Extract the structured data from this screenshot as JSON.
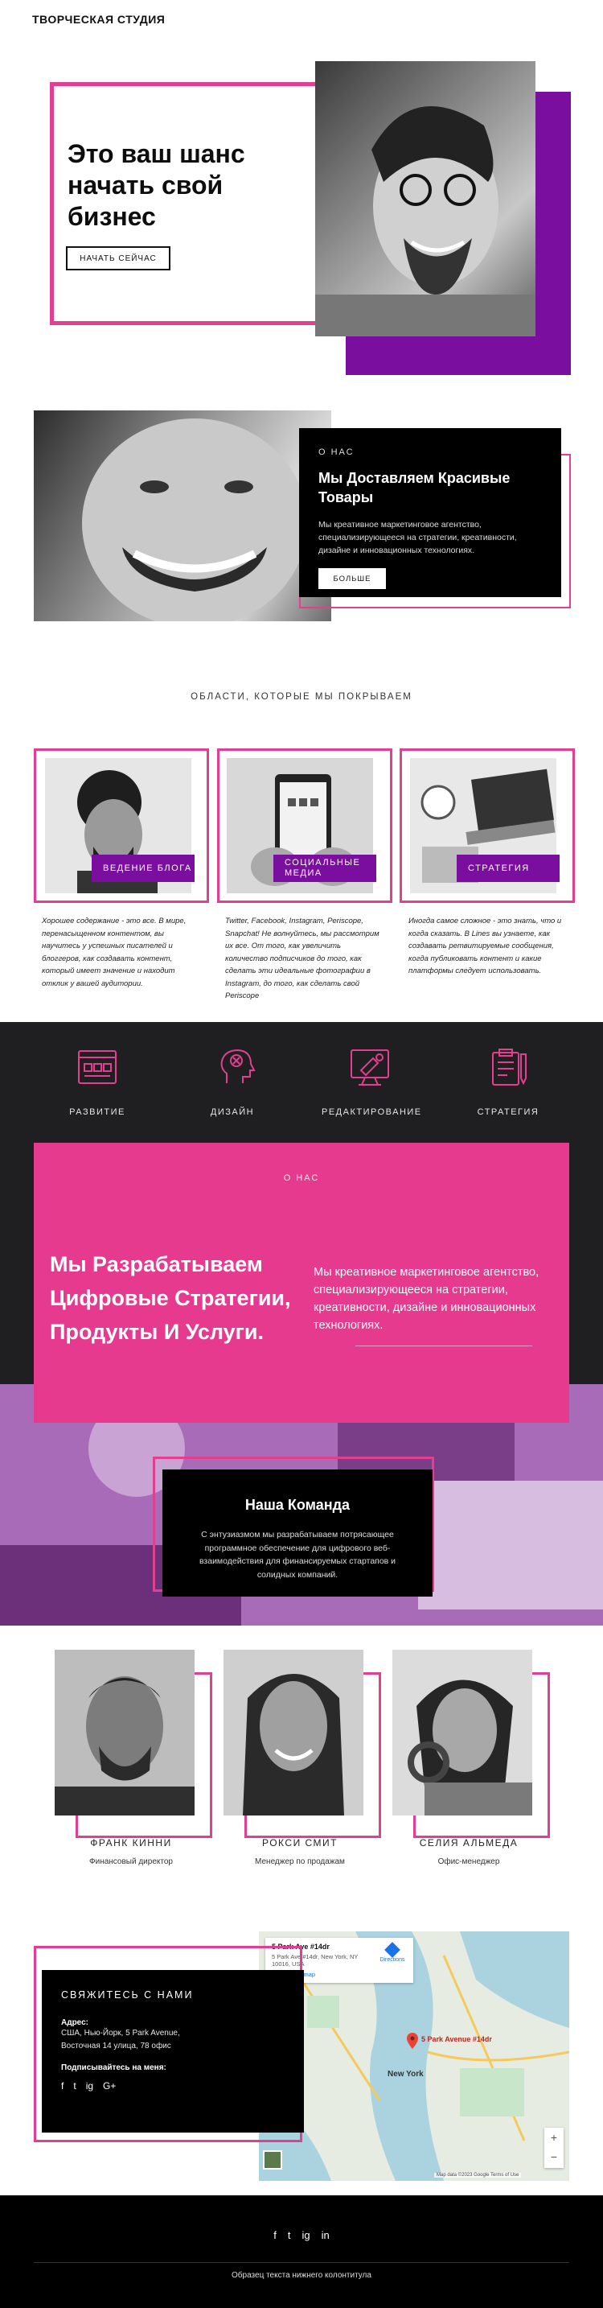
{
  "header": {
    "title": "ТВОРЧЕСКАЯ СТУДИЯ"
  },
  "hero": {
    "headline": "Это ваш шанс начать свой бизнес",
    "button": "НАЧАТЬ СЕЙЧАС"
  },
  "about": {
    "eyebrow": "О НАС",
    "title": "Мы Доставляем Красивые Товары",
    "text": "Мы креативное маркетинговое агентство, специализирующееся на стратегии, креативности, дизайне и инновационных технологиях.",
    "button": "БОЛЬШЕ"
  },
  "areas": {
    "caption": "ОБЛАСТИ, КОТОРЫЕ МЫ ПОКРЫВАЕМ",
    "cards": [
      {
        "tag": "ВЕДЕНИЕ БЛОГА",
        "text": "Хорошее содержание - это все. В мире, перенасыщенном контентом, вы научитесь у успешных писателей и блоггеров, как создавать контент, который имеет значение и находит отклик у вашей аудитории."
      },
      {
        "tag": "СОЦИАЛЬНЫЕ МЕДИА",
        "text": "Twitter, Facebook, Instagram, Periscope, Snapchat! Не волнуйтесь, мы рассмотрим их все. От того, как увеличить количество подписчиков до того, как сделать эти идеальные фотографии в Instagram, до того, как сделать свой Periscope"
      },
      {
        "tag": "СТРАТЕГИЯ",
        "text": "Иногда самое сложное - это знать, что и когда сказать. В Lines вы узнаете, как создавать ретвитируемые сообщения, когда публиковать контент и какие платформы следует использовать."
      }
    ]
  },
  "services": [
    {
      "label": "РАЗВИТИЕ",
      "icon": "browser-grid-icon"
    },
    {
      "label": "ДИЗАЙН",
      "icon": "head-idea-icon"
    },
    {
      "label": "РЕДАКТИРОВАНИЕ",
      "icon": "monitor-edit-icon"
    },
    {
      "label": "СТРАТЕГИЯ",
      "icon": "clipboard-strategy-icon"
    }
  ],
  "pink_about": {
    "eyebrow": "О НАС",
    "title": "Мы Разрабатываем Цифровые Стратегии, Продукты И Услуги.",
    "text": "Мы креативное маркетинговое агентство, специализирующееся на стратегии, креативности, дизайне и инновационных технологиях."
  },
  "team": {
    "title": "Наша Команда",
    "text": "С энтузиазмом мы разрабатываем потрясающее программное обеспечение для цифрового веб-взаимодействия для финансируемых стартапов и солидных компаний.",
    "members": [
      {
        "name": "ФРАНК КИННИ",
        "role": "Финансовый директор"
      },
      {
        "name": "РОКСИ СМИТ",
        "role": "Менеджер по продажам"
      },
      {
        "name": "СЕЛИЯ АЛЬМЕДА",
        "role": "Офис-менеджер"
      }
    ]
  },
  "contact": {
    "title": "СВЯЖИТЕСЬ С НАМИ",
    "address_label": "Адрес:",
    "address": "США, Нью-Йорк, 5 Park Avenue, Восточная 14 улица, 78 офис",
    "follow_label": "Подписывайтесь на меня:",
    "socials": [
      "f",
      "t",
      "ig",
      "G+"
    ]
  },
  "map": {
    "card_title": "5 Park Ave #14dr",
    "card_addr": "5 Park Ave #14dr, New York, NY 10016, USA",
    "card_link": "View larger map",
    "directions": "Directions",
    "pin_label": "5 Park Avenue #14dr",
    "city_label": "New York",
    "zoom_in": "+",
    "zoom_out": "−",
    "attribution": "Map data ©2023 Google   Terms of Use"
  },
  "footer": {
    "socials": [
      "f",
      "t",
      "ig",
      "in"
    ],
    "text": "Образец текста нижнего колонтитула"
  },
  "colors": {
    "pink": "#e0408f",
    "purple": "#7a0e9e",
    "dark": "#1f1f21",
    "hot_pink": "#e53a8e"
  }
}
